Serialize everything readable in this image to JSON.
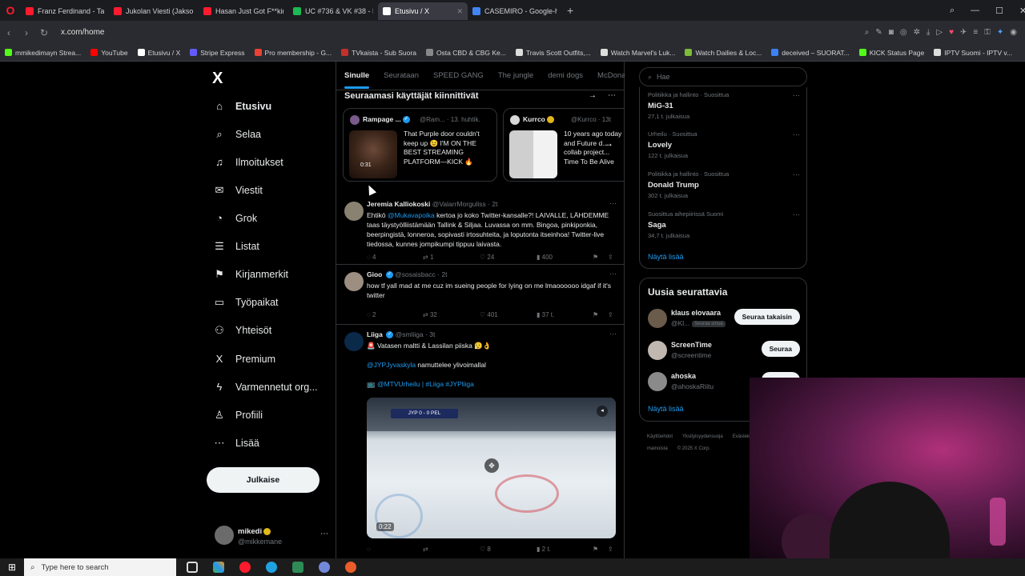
{
  "browser": {
    "tabs": [
      {
        "label": "Franz Ferdinand - Take M",
        "color": "#ff1b2d"
      },
      {
        "label": "Jukolan Viesti (Jakso 3, Ka",
        "color": "#ff1b2d"
      },
      {
        "label": "Hasan Just Got F**king De",
        "color": "#ff1b2d"
      },
      {
        "label": "UC #736 & VK #38 - E",
        "color": "#1db954"
      },
      {
        "label": "Etusivu / X",
        "color": "#ffffff",
        "active": true
      },
      {
        "label": "CASEMIRO - Google-haku",
        "color": "#4285f4"
      }
    ],
    "url": "x.com/home",
    "bookmarks": [
      {
        "label": "mmikedimayn Strea...",
        "color": "#53fc18"
      },
      {
        "label": "YouTube",
        "color": "#ff0000"
      },
      {
        "label": "Etusivu / X",
        "color": "#ffffff"
      },
      {
        "label": "Stripe Express",
        "color": "#635bff"
      },
      {
        "label": "Pro membership - G...",
        "color": "#e94235"
      },
      {
        "label": "TVkaista - Sub Suora",
        "color": "#c4302b"
      },
      {
        "label": "Osta CBD & CBG Ke...",
        "color": "#888888"
      },
      {
        "label": "Travis Scott Outfits,...",
        "color": "#dddddd"
      },
      {
        "label": "Watch Marvel's Luk...",
        "color": "#dddddd"
      },
      {
        "label": "Watch Dailies & Loc...",
        "color": "#7dbb3a"
      },
      {
        "label": "deceived – SUORAT...",
        "color": "#3b82f6"
      },
      {
        "label": "KICK Status Page",
        "color": "#53fc18"
      },
      {
        "label": "IPTV Suomi - IPTV v...",
        "color": "#dddddd"
      }
    ]
  },
  "sidebar": {
    "logo": "X",
    "items": [
      {
        "label": "Etusivu",
        "icon": "home-icon",
        "glyph": "⌂"
      },
      {
        "label": "Selaa",
        "icon": "search-icon",
        "glyph": "⌕"
      },
      {
        "label": "Ilmoitukset",
        "icon": "bell-icon",
        "glyph": "♫"
      },
      {
        "label": "Viestit",
        "icon": "mail-icon",
        "glyph": "✉"
      },
      {
        "label": "Grok",
        "icon": "grok-icon",
        "glyph": "◔"
      },
      {
        "label": "Listat",
        "icon": "list-icon",
        "glyph": "☰"
      },
      {
        "label": "Kirjanmerkit",
        "icon": "bookmark-icon",
        "glyph": "⚑"
      },
      {
        "label": "Työpaikat",
        "icon": "briefcase-icon",
        "glyph": "▭"
      },
      {
        "label": "Yhteisöt",
        "icon": "communities-icon",
        "glyph": "⚇"
      },
      {
        "label": "Premium",
        "icon": "x-premium-icon",
        "glyph": "X"
      },
      {
        "label": "Varmennetut org...",
        "icon": "lightning-icon",
        "glyph": "ϟ"
      },
      {
        "label": "Profiili",
        "icon": "profile-icon",
        "glyph": "♙"
      },
      {
        "label": "Lisää",
        "icon": "more-icon",
        "glyph": "⋯"
      }
    ],
    "post_button": "Julkaise",
    "account": {
      "name": "mikedi",
      "handle": "@mikkemane"
    }
  },
  "timeline": {
    "tabs": [
      "Sinulle",
      "Seurataan",
      "SPEED GANG",
      "The jungle",
      "demi dogs",
      "McDonal"
    ],
    "section_title": "Seuraamasi käyttäjät kiinnittivät",
    "cards": [
      {
        "name": "Rampage ...",
        "meta": "@Ram... · 13. huhtik.",
        "text": "That Purple door couldn't keep up 😉 I'M ON THE BEST STREAMING PLATFORM—KICK 🔥",
        "duration": "0:31"
      },
      {
        "name": "Kurrco",
        "meta": "@Kurrco · 13t",
        "text": "10 years ago today and Future d... collab project... Time To Be Alive"
      }
    ],
    "tweets": [
      {
        "name": "Jeremia Kalliokoski",
        "meta": "@ValarrMorguliss · 2t",
        "body_pre": "Ehtikö ",
        "mention": "@Mukavapoika",
        "body_post": " kertoa jo koko Twitter-kansalle?! LAIVALLE, LÄHDEMME taas täystyölliistämään Tallink & Siljaa. Luvassa on mm. Bingoa, pinkiponkia, beerpingistä, lonneroa, sopivasti irtosuhteita, ja loputonta itseinhoa! Twitter-live tiedossa, kunnes jompikumpi tippuu laivasta.",
        "replies": "4",
        "reposts": "1",
        "likes": "24",
        "views": "400"
      },
      {
        "name": "Gioo",
        "meta": "@sosaisbacc · 2t",
        "body": "how tf yall mad at me cuz im sueing people for lying on me lmaoooooo idgaf if it's twitter",
        "replies": "2",
        "reposts": "32",
        "likes": "401",
        "views": "37 t."
      },
      {
        "name": "Liiga",
        "meta": "@smliiga · 3t",
        "line1": "🚨 Vatasen maltti & Lassilan piiska 😮‍💨👌",
        "mention": "@JYPJyvaskyla",
        "line2": " namuttelee ylivoimallal",
        "line3_pre": "📺 ",
        "tags": "@MTVUrheilu | #Liiga #JYPliiga",
        "video_duration": "0:22",
        "scoreboard": "JYP  0 - 0  PEL",
        "replies": "",
        "reposts": "",
        "likes": "8",
        "views": "2 t."
      }
    ]
  },
  "right": {
    "search_placeholder": "Hae",
    "trends": [
      {
        "category": "Politiikka ja hallinto · Suosittua",
        "name": "MiG-31",
        "posts": "27,1 t. julkaisua"
      },
      {
        "category": "Urheilu · Suosittua",
        "name": "Lovely",
        "posts": "122 t. julkaisua"
      },
      {
        "category": "Politiikka ja hallinto · Suosittua",
        "name": "Donald Trump",
        "posts": "302 t. julkaisua"
      },
      {
        "category": "Suosittua aihepiirissä Suomi",
        "name": "Saga",
        "posts": "34,7 t. julkaisua"
      }
    ],
    "show_more": "Näytä lisää",
    "who_to_follow_title": "Uusia seurattavia",
    "who_to_follow": [
      {
        "name": "klaus elovaara",
        "handle": "@Kl...",
        "badge": "Seuraa sinua",
        "button": "Seuraa takaisin",
        "color": "#6b5b4a"
      },
      {
        "name": "ScreenTime",
        "handle": "@screentime",
        "button": "Seuraa",
        "color": "#c0b7b0"
      },
      {
        "name": "ahoska",
        "handle": "@ahoskaRiitu",
        "button": "Seuraa",
        "color": "#8a8a8a"
      }
    ],
    "show_more_2": "Näytä lisää",
    "footer": [
      "Käyttöehdot",
      "Yksityisyydensuoja",
      "Evästekäytäntö",
      "Tietoa mainoista",
      "© 2025 X Corp."
    ]
  },
  "taskbar": {
    "search_placeholder": "Type here to search"
  }
}
